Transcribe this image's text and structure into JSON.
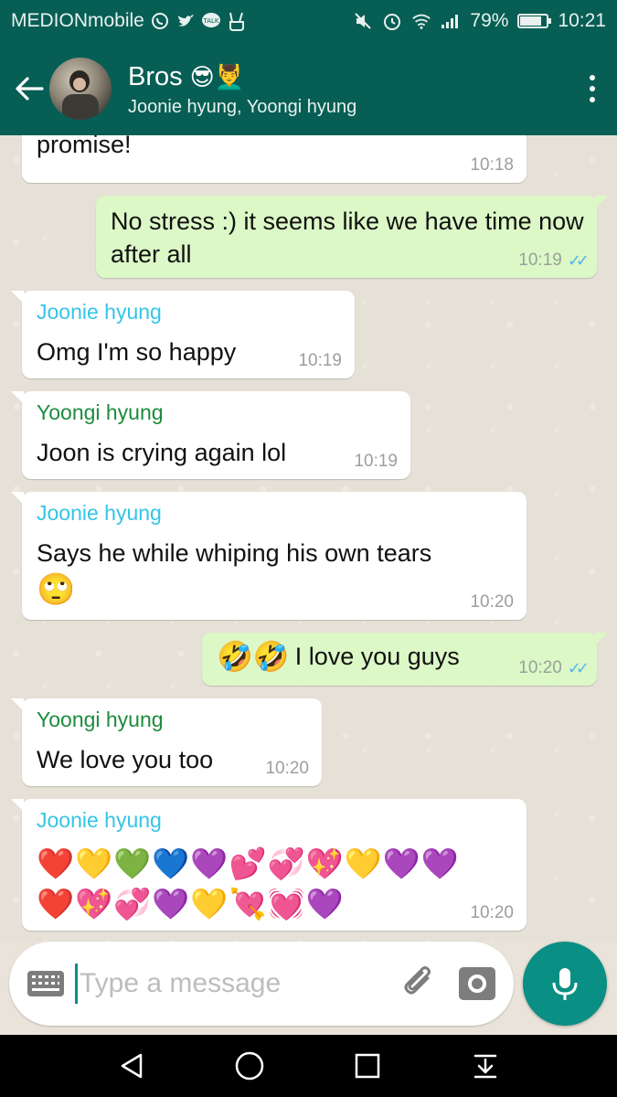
{
  "status_bar": {
    "carrier": "MEDIONmobile",
    "battery": "79%",
    "battery_level": 0.79,
    "time": "10:21",
    "icons": [
      "whatsapp-icon",
      "twitter-icon",
      "talk-icon",
      "peace-icon",
      "mute-icon",
      "alarm-icon",
      "wifi-icon",
      "signal-icon",
      "battery-icon"
    ]
  },
  "header": {
    "title": "Bros",
    "title_emoji": "😎💆‍♂️",
    "subtitle": "Joonie hyung, Yoongi hyung"
  },
  "messages": [
    {
      "direction": "in",
      "sender": "",
      "text": "promise!",
      "time": "10:18"
    },
    {
      "direction": "out",
      "text": "No stress :) it seems like we have time now after all",
      "time": "10:19"
    },
    {
      "direction": "in",
      "sender": "Joonie hyung",
      "text": "Omg I'm so happy",
      "time": "10:19"
    },
    {
      "direction": "in",
      "sender": "Yoongi hyung",
      "text": "Joon is crying again lol",
      "time": "10:19"
    },
    {
      "direction": "in",
      "sender": "Joonie hyung",
      "text": "Says he while whiping his own tears",
      "emoji": "🙄",
      "time": "10:20"
    },
    {
      "direction": "out",
      "emoji": "🤣🤣",
      "text": "I love you guys",
      "time": "10:20"
    },
    {
      "direction": "in",
      "sender": "Yoongi hyung",
      "text": "We love you too",
      "time": "10:20"
    },
    {
      "direction": "in",
      "sender": "Joonie hyung",
      "line1": "❤️💛💚💙💜💕💞💖💛💜💜",
      "line2": "❤️💖💞💜💛💘💓💜",
      "time": "10:20"
    }
  ],
  "input": {
    "placeholder": "Type a message"
  },
  "colors": {
    "header": "#075e54",
    "outgoing_bubble": "#dcf8c6",
    "incoming_bubble": "#ffffff",
    "joonie_name": "#35c5e6",
    "yoongi_name": "#1c8c3d",
    "read_tick": "#4fb6ec",
    "mic_button": "#0a8f84"
  }
}
